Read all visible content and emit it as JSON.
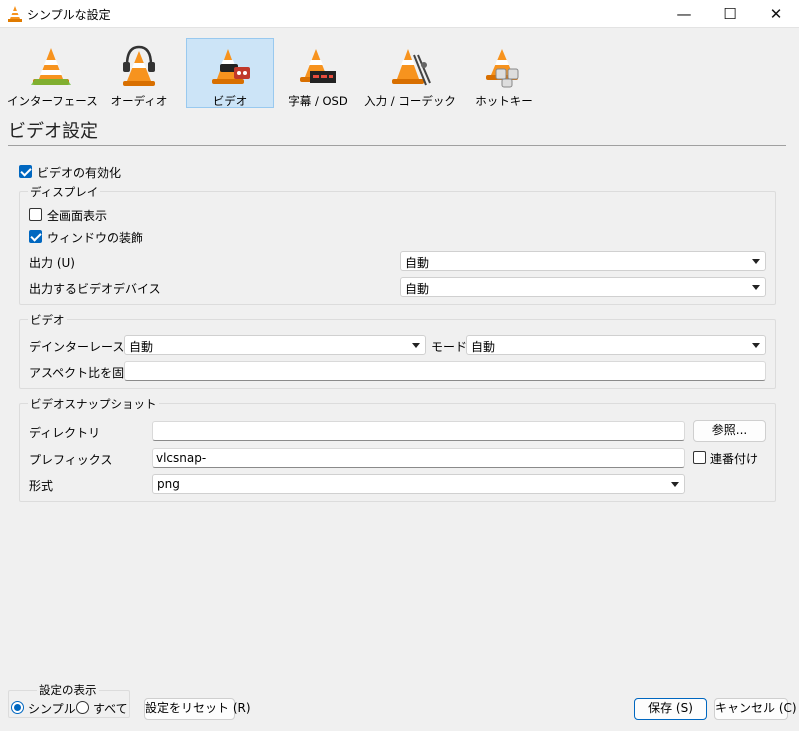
{
  "window": {
    "title": "シンプルな設定",
    "minimize": "—",
    "maximize": "☐",
    "close": "✕"
  },
  "categories": [
    {
      "label": "インターフェース",
      "icon": "interface-cone-icon"
    },
    {
      "label": "オーディオ",
      "icon": "audio-cone-headphones-icon"
    },
    {
      "label": "ビデオ",
      "icon": "video-cone-icon",
      "selected": true
    },
    {
      "label": "字幕 / OSD",
      "icon": "subtitles-cone-icon"
    },
    {
      "label": "入力 / コーデック",
      "icon": "input-codec-cone-icon"
    },
    {
      "label": "ホットキー",
      "icon": "hotkeys-cone-icon"
    }
  ],
  "section_title": "ビデオ設定",
  "enable_video": {
    "label": "ビデオの有効化",
    "checked": true
  },
  "display": {
    "title": "ディスプレイ",
    "fullscreen": {
      "label": "全画面表示",
      "checked": false
    },
    "window_decorations": {
      "label": "ウィンドウの装飾",
      "checked": true
    },
    "output_label": "出力 (U)",
    "output_value": "自動",
    "device_label": "出力するビデオデバイス",
    "device_value": "自動"
  },
  "video": {
    "title": "ビデオ",
    "deinterlace_label": "デインターレース",
    "deinterlace_value": "自動",
    "mode_label": "モード",
    "mode_value": "自動",
    "aspect_label": "アスペクト比を固定",
    "aspect_value": ""
  },
  "snapshot": {
    "title": "ビデオスナップショット",
    "directory_label": "ディレクトリ",
    "directory_value": "",
    "browse_button": "参照...",
    "prefix_label": "プレフィックス",
    "prefix_value": "vlcsnap-",
    "sequential_label": "連番付け",
    "sequential_checked": false,
    "format_label": "形式",
    "format_value": "png"
  },
  "show_settings": {
    "title": "設定の表示",
    "simple_label": "シンプル",
    "all_label": "すべて",
    "selected": "simple"
  },
  "buttons": {
    "reset": "設定をリセット (R)",
    "save": "保存 (S)",
    "cancel": "キャンセル (C)"
  },
  "colors": {
    "accent": "#0067c0",
    "selected_tab_bg": "#cce4f7",
    "cone_orange": "#f7931e"
  }
}
